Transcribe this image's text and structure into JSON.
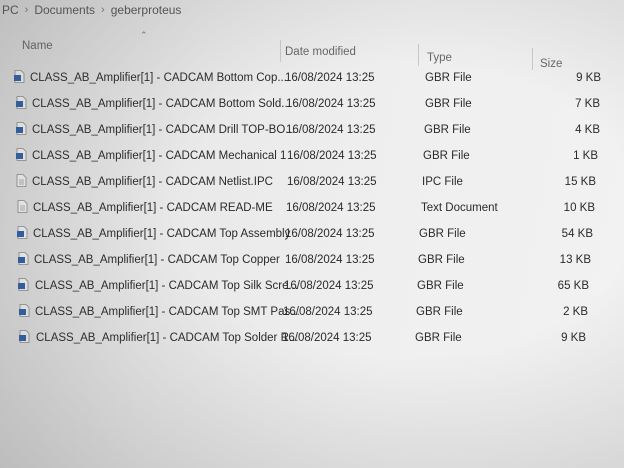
{
  "breadcrumb": {
    "items": [
      "PC",
      "Documents",
      "geberproteus"
    ]
  },
  "columns": {
    "name": "Name",
    "date": "Date modified",
    "type": "Type",
    "size": "Size"
  },
  "files": [
    {
      "name": "CLASS_AB_Amplifier[1] - CADCAM Bottom Cop...",
      "date": "16/08/2024 13:25",
      "type": "GBR File",
      "size": "9 KB",
      "icon": "gbr-file-icon"
    },
    {
      "name": "CLASS_AB_Amplifier[1] - CADCAM Bottom Sold...",
      "date": "16/08/2024 13:25",
      "type": "GBR File",
      "size": "7 KB",
      "icon": "gbr-file-icon"
    },
    {
      "name": "CLASS_AB_Amplifier[1] - CADCAM Drill TOP-BO...",
      "date": "16/08/2024 13:25",
      "type": "GBR File",
      "size": "4 KB",
      "icon": "gbr-file-icon"
    },
    {
      "name": "CLASS_AB_Amplifier[1] - CADCAM Mechanical 1",
      "date": "16/08/2024 13:25",
      "type": "GBR File",
      "size": "1 KB",
      "icon": "gbr-file-icon"
    },
    {
      "name": "CLASS_AB_Amplifier[1] - CADCAM Netlist.IPC",
      "date": "16/08/2024 13:25",
      "type": "IPC File",
      "size": "15 KB",
      "icon": "generic-file-icon"
    },
    {
      "name": "CLASS_AB_Amplifier[1] - CADCAM READ-ME",
      "date": "16/08/2024 13:25",
      "type": "Text Document",
      "size": "10 KB",
      "icon": "text-file-icon"
    },
    {
      "name": "CLASS_AB_Amplifier[1] - CADCAM Top Assembly",
      "date": "16/08/2024 13:25",
      "type": "GBR File",
      "size": "54 KB",
      "icon": "gbr-file-icon"
    },
    {
      "name": "CLASS_AB_Amplifier[1] - CADCAM Top Copper",
      "date": "16/08/2024 13:25",
      "type": "GBR File",
      "size": "13 KB",
      "icon": "gbr-file-icon"
    },
    {
      "name": "CLASS_AB_Amplifier[1] - CADCAM Top Silk Scre...",
      "date": "16/08/2024 13:25",
      "type": "GBR File",
      "size": "65 KB",
      "icon": "gbr-file-icon"
    },
    {
      "name": "CLASS_AB_Amplifier[1] - CADCAM Top SMT Pas...",
      "date": "16/08/2024 13:25",
      "type": "GBR File",
      "size": "2 KB",
      "icon": "gbr-file-icon"
    },
    {
      "name": "CLASS_AB_Amplifier[1] - CADCAM Top Solder R...",
      "date": "16/08/2024 13:25",
      "type": "GBR File",
      "size": "9 KB",
      "icon": "gbr-file-icon"
    }
  ],
  "colors": {
    "gbr_icon": "#2f5fa8",
    "generic_icon": "#9a9a9a",
    "text_icon": "#a0a0a0"
  }
}
